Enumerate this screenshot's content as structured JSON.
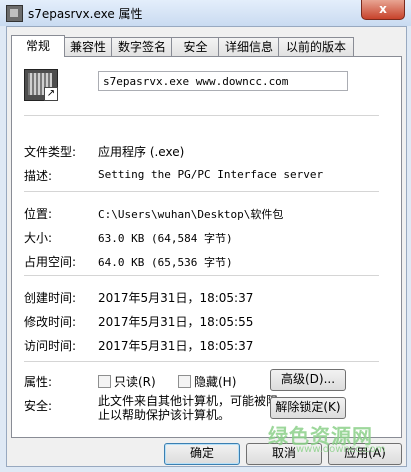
{
  "window": {
    "title": "s7epasrvx.exe 属性",
    "close": "x"
  },
  "tabs": [
    "常规",
    "兼容性",
    "数字签名",
    "安全",
    "详细信息",
    "以前的版本"
  ],
  "file": {
    "name": "s7epasrvx.exe  www.downcc.com"
  },
  "rows": {
    "type": {
      "label": "文件类型:",
      "value": "应用程序 (.exe)"
    },
    "desc": {
      "label": "描述:",
      "value": "Setting the PG/PC Interface server"
    },
    "location": {
      "label": "位置:",
      "value": "C:\\Users\\wuhan\\Desktop\\软件包"
    },
    "size": {
      "label": "大小:",
      "value": "63.0 KB (64,584 字节)"
    },
    "disk": {
      "label": "占用空间:",
      "value": "64.0 KB (65,536 字节)"
    },
    "created": {
      "label": "创建时间:",
      "value": "2017年5月31日，18:05:37"
    },
    "modified": {
      "label": "修改时间:",
      "value": "2017年5月31日，18:05:55"
    },
    "accessed": {
      "label": "访问时间:",
      "value": "2017年5月31日，18:05:37"
    }
  },
  "attributes": {
    "label": "属性:",
    "readonly": "只读(R)",
    "hidden": "隐藏(H)",
    "advanced": "高级(D)..."
  },
  "security": {
    "label": "安全:",
    "text": "此文件来自其他计算机，可能被阻止以帮助保护该计算机。",
    "unblock": "解除锁定(K)"
  },
  "buttons": {
    "ok": "确定",
    "cancel": "取消",
    "apply": "应用(A)"
  },
  "watermark": {
    "main": "绿色资源网",
    "sub": "www.downcc.com"
  }
}
